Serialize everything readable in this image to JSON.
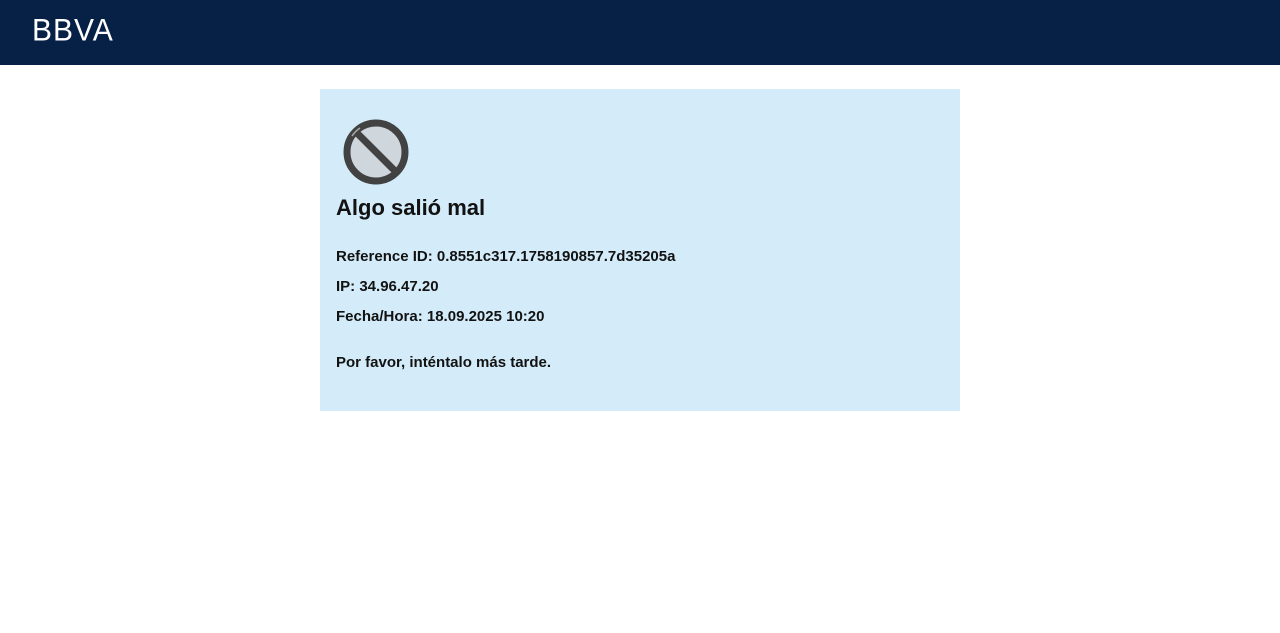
{
  "header": {
    "logo_text": "BBVA",
    "background_color": "#072146"
  },
  "error": {
    "icon": "prohibited-icon",
    "title": "Algo salió mal",
    "reference_label": "Reference ID:",
    "reference_value": "0.8551c317.1758190857.7d35205a",
    "ip_label": "IP:",
    "ip_value": "34.96.47.20",
    "datetime_label": "Fecha/Hora:",
    "datetime_value": "18.09.2025 10:20",
    "retry_message": "Por favor, inténtalo más tarde.",
    "card_color": "#d4ecfa"
  }
}
